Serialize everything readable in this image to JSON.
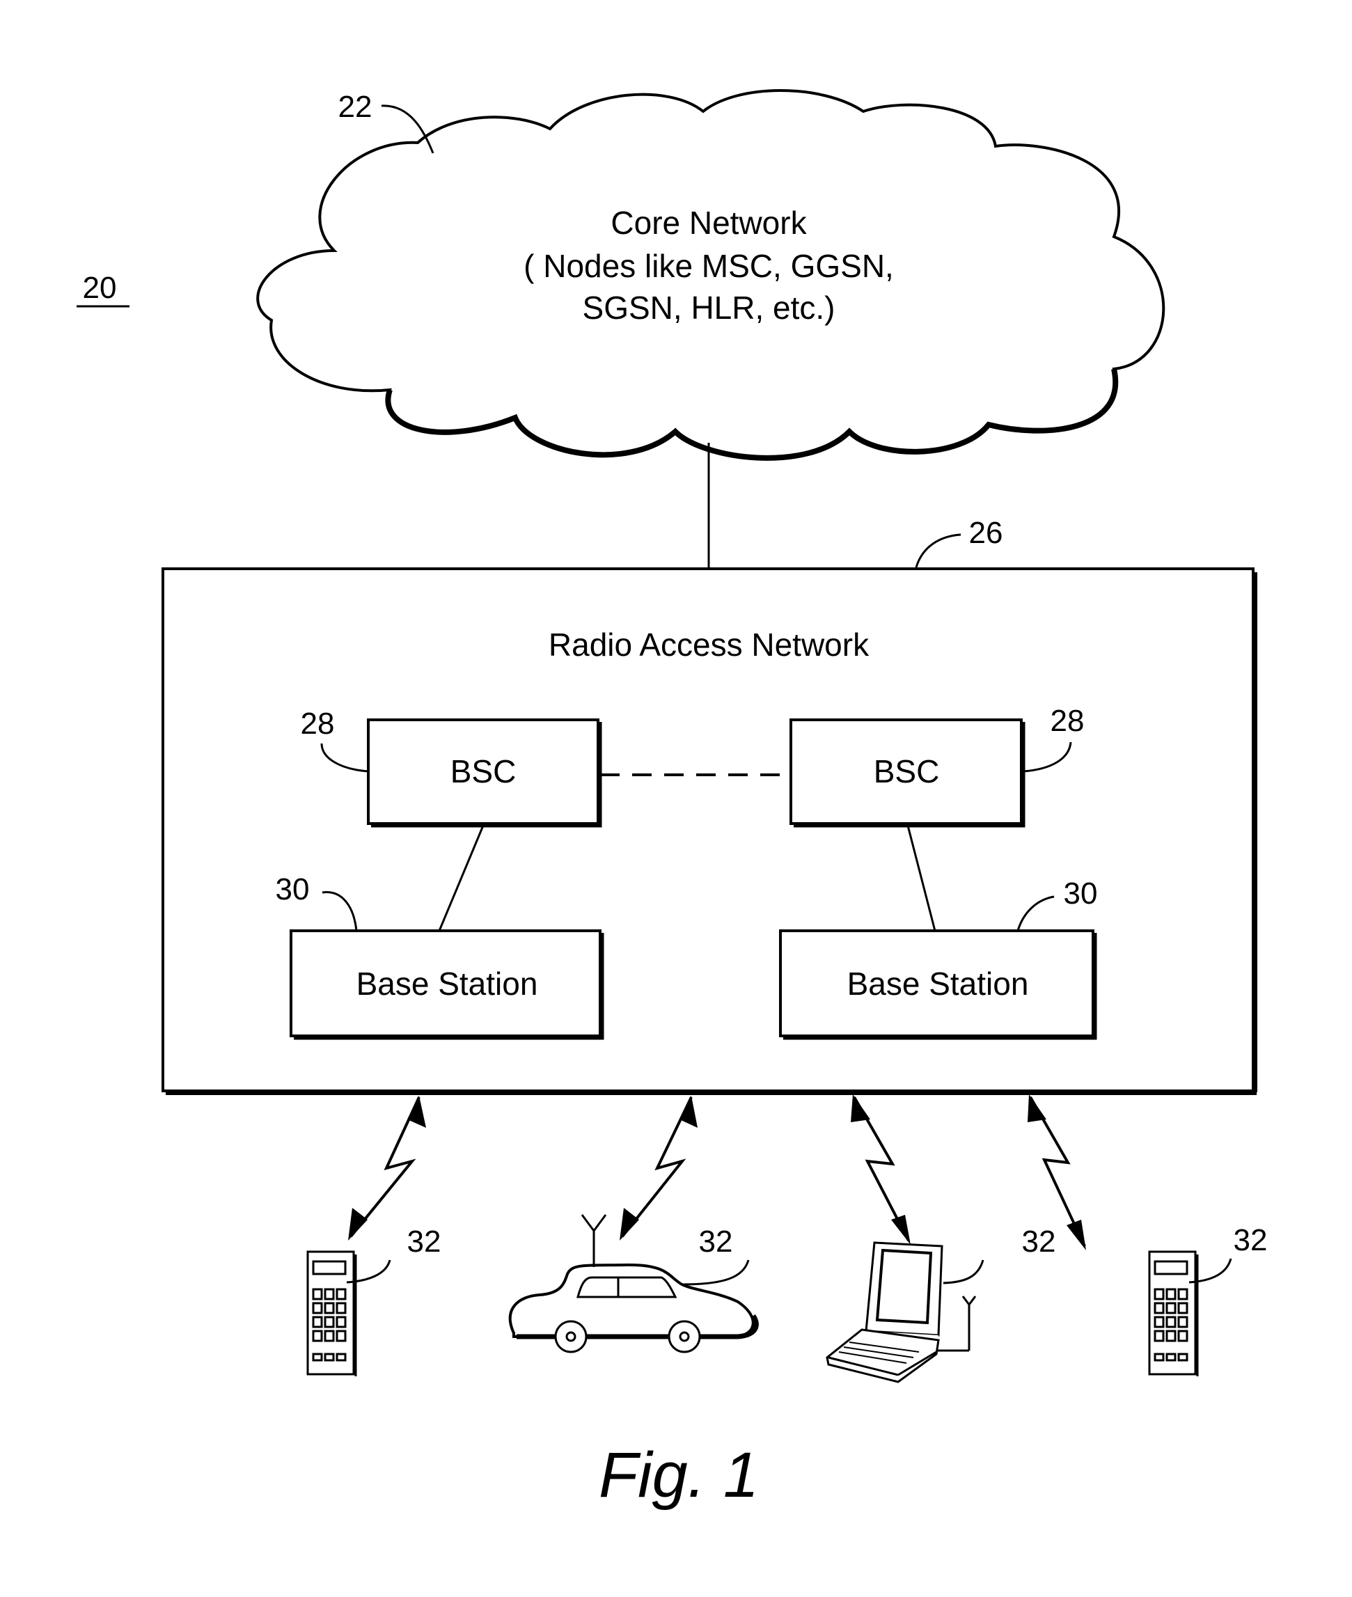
{
  "figure": {
    "number_label": "20",
    "caption": "Fig. 1"
  },
  "core_network": {
    "ref": "22",
    "title": "Core Network",
    "line2": "( Nodes like MSC, GGSN,",
    "line3": "SGSN, HLR, etc.)"
  },
  "ran": {
    "ref": "26",
    "title": "Radio Access Network",
    "bsc": [
      {
        "ref": "28",
        "label": "BSC"
      },
      {
        "ref": "28",
        "label": "BSC"
      }
    ],
    "base_stations": [
      {
        "ref": "30",
        "label": "Base Station"
      },
      {
        "ref": "30",
        "label": "Base Station"
      }
    ]
  },
  "devices": [
    {
      "ref": "32",
      "type": "mobile-phone"
    },
    {
      "ref": "32",
      "type": "car"
    },
    {
      "ref": "32",
      "type": "laptop"
    },
    {
      "ref": "32",
      "type": "mobile-phone"
    }
  ]
}
